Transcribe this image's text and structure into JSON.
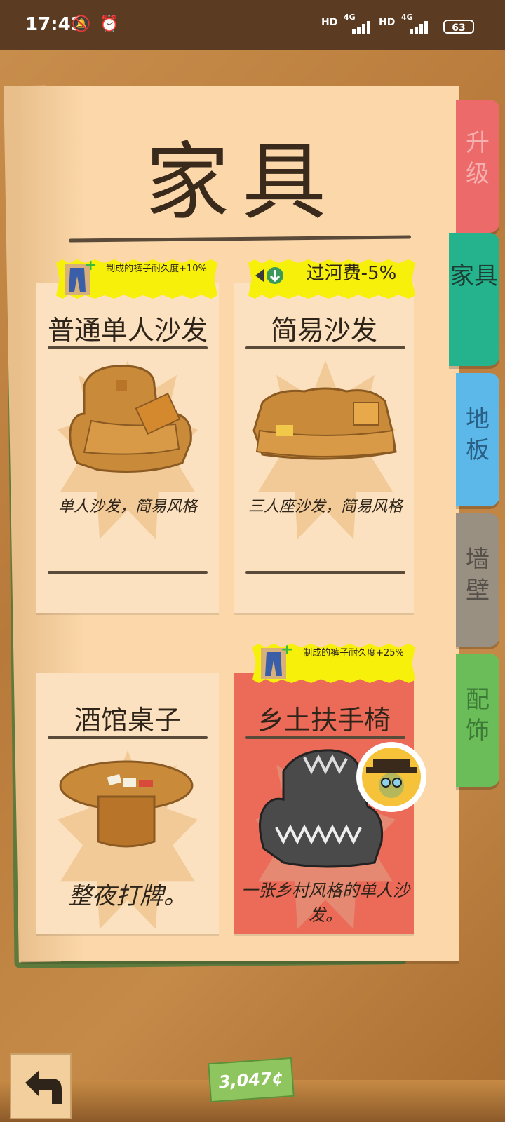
{
  "status_bar": {
    "time": "17:43",
    "signal1_label": "HD",
    "signal1_net": "4G",
    "signal2_label": "HD",
    "signal2_net": "4G",
    "battery": "63"
  },
  "page": {
    "title": "家具"
  },
  "items": [
    {
      "name": "普通单人沙发",
      "description": "单人沙发，简易风格",
      "badge": "制成的裤子耐久度+10%",
      "badge_icon": "jeans-icon"
    },
    {
      "name": "简易沙发",
      "description": "三人座沙发，简易风格",
      "badge": "过河费-5%",
      "badge_icon": "toll-down-icon"
    },
    {
      "name": "酒馆桌子",
      "description": "整夜打牌。",
      "badge": "",
      "badge_icon": ""
    },
    {
      "name": "乡土扶手椅",
      "description": "一张乡村风格的单人沙发。",
      "badge": "制成的裤子耐久度+25%",
      "badge_icon": "jeans-icon",
      "selected": true
    }
  ],
  "tabs": [
    {
      "label": "升级",
      "color": "#ec6a6a",
      "text_color": "#f5b0b0"
    },
    {
      "label": "家具",
      "color": "#24b38c",
      "text_color": "#1e3d33",
      "active": true
    },
    {
      "label": "地板",
      "color": "#5bb8e8",
      "text_color": "#2a5f86"
    },
    {
      "label": "墙壁",
      "color": "#9a9082",
      "text_color": "#55504a"
    },
    {
      "label": "配饰",
      "color": "#6bbd5a",
      "text_color": "#3c7a35"
    }
  ],
  "money": "3,047¢",
  "icons": {
    "back": "back-arrow-icon",
    "avatar": "character-avatar-icon"
  }
}
